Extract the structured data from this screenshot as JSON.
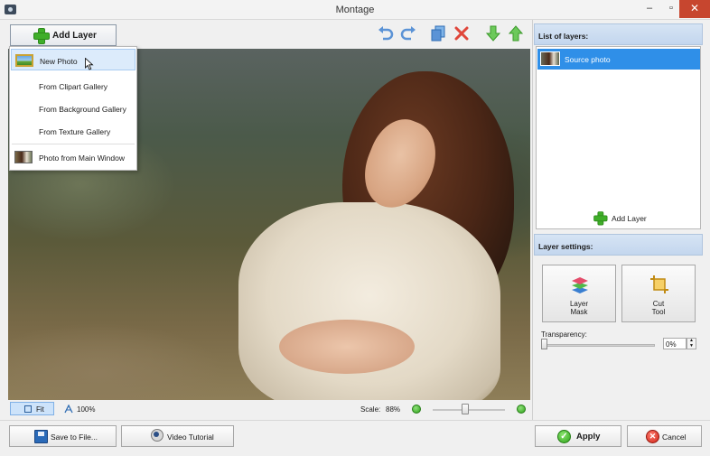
{
  "window": {
    "title": "Montage"
  },
  "toolbar": {
    "add_layer_label": "Add Layer",
    "icons": [
      "undo-icon",
      "redo-icon",
      "copy-icon",
      "delete-icon",
      "move-down-icon",
      "move-up-icon"
    ]
  },
  "add_layer_menu": {
    "items": [
      {
        "label": "New Photo",
        "selected": true
      },
      {
        "label": "From Clipart Gallery"
      },
      {
        "label": "From Background Gallery"
      },
      {
        "label": "From Texture Gallery"
      },
      {
        "label": "Photo from Main Window"
      }
    ]
  },
  "view": {
    "fit_label": "Fit",
    "zoom_label": "100%",
    "scale_label": "Scale:",
    "scale_value": "88%"
  },
  "layers_panel": {
    "header": "List of layers:",
    "layers": [
      {
        "name": "Source photo",
        "selected": true
      }
    ],
    "add_label": "Add Layer"
  },
  "layer_settings": {
    "header": "Layer settings:",
    "mask_label": "Layer\nMask",
    "cut_label": "Cut\nTool",
    "transparency_label": "Transparency:",
    "transparency_value": "0%"
  },
  "footer": {
    "save_label": "Save to File...",
    "video_label": "Video Tutorial",
    "apply_label": "Apply",
    "cancel_label": "Cancel"
  },
  "colors": {
    "accent": "#2f8fe8",
    "apply_green": "#2fa21a",
    "cancel_red": "#cf2519"
  }
}
